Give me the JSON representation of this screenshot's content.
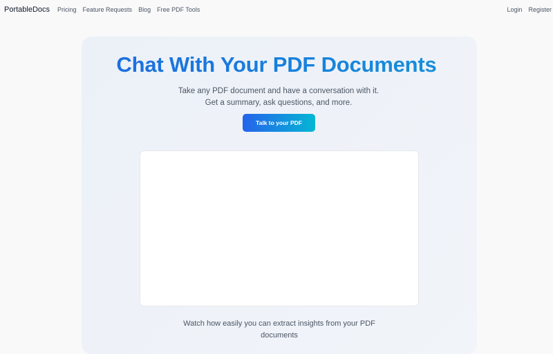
{
  "nav": {
    "brand": "PortableDocs",
    "links": [
      "Pricing",
      "Feature Requests",
      "Blog",
      "Free PDF Tools"
    ],
    "login": "Login",
    "register": "Register"
  },
  "hero": {
    "title": "Chat With Your PDF Documents",
    "subtitle": "Take any PDF document and have a conversation with it. Get a summary, ask questions, and more.",
    "cta_label": "Talk to your PDF",
    "caption": "Watch how easily you can extract insights from your PDF documents"
  },
  "colors": {
    "title_gradient_start": "#1e64e0",
    "title_gradient_end": "#149ad8",
    "button_gradient_start": "#2563eb",
    "button_gradient_end": "#06b6d4"
  }
}
